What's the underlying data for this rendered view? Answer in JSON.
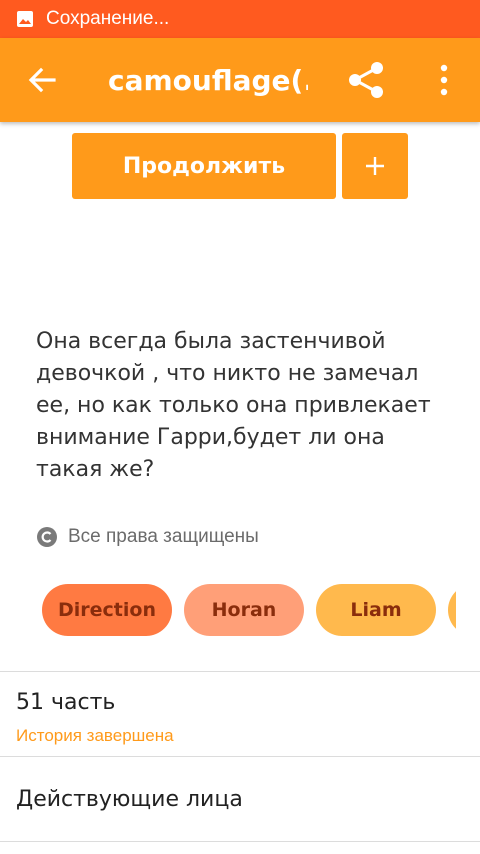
{
  "status_bar": {
    "text": "Сохранение...",
    "color": "#ff5a1f",
    "icon": "image-icon"
  },
  "app_bar": {
    "title": "camouflage(...",
    "color": "#ff9a1a",
    "icons": [
      "back-arrow-icon",
      "share-icon",
      "more-vert-icon"
    ]
  },
  "actions": {
    "continue_label": "Продолжить",
    "add_icon": "plus-icon"
  },
  "description": "Она  всегда была застенчивой девочкой , что никто не замечал ее, но как только она привлекает внимание Гарри,будет ли она такая же?",
  "copyright": {
    "icon": "copyright-icon",
    "text": "Все права защищены"
  },
  "tags": [
    {
      "label": "Direction",
      "color": "#ff7a42"
    },
    {
      "label": "Horan",
      "color": "#ff9f78"
    },
    {
      "label": "Liam",
      "color": "#ffb94d"
    },
    {
      "label": "",
      "color": "#ffb94d"
    }
  ],
  "chapters": {
    "title": "51 часть",
    "status": "История завершена"
  },
  "characters": {
    "title": "Действующие лица"
  }
}
